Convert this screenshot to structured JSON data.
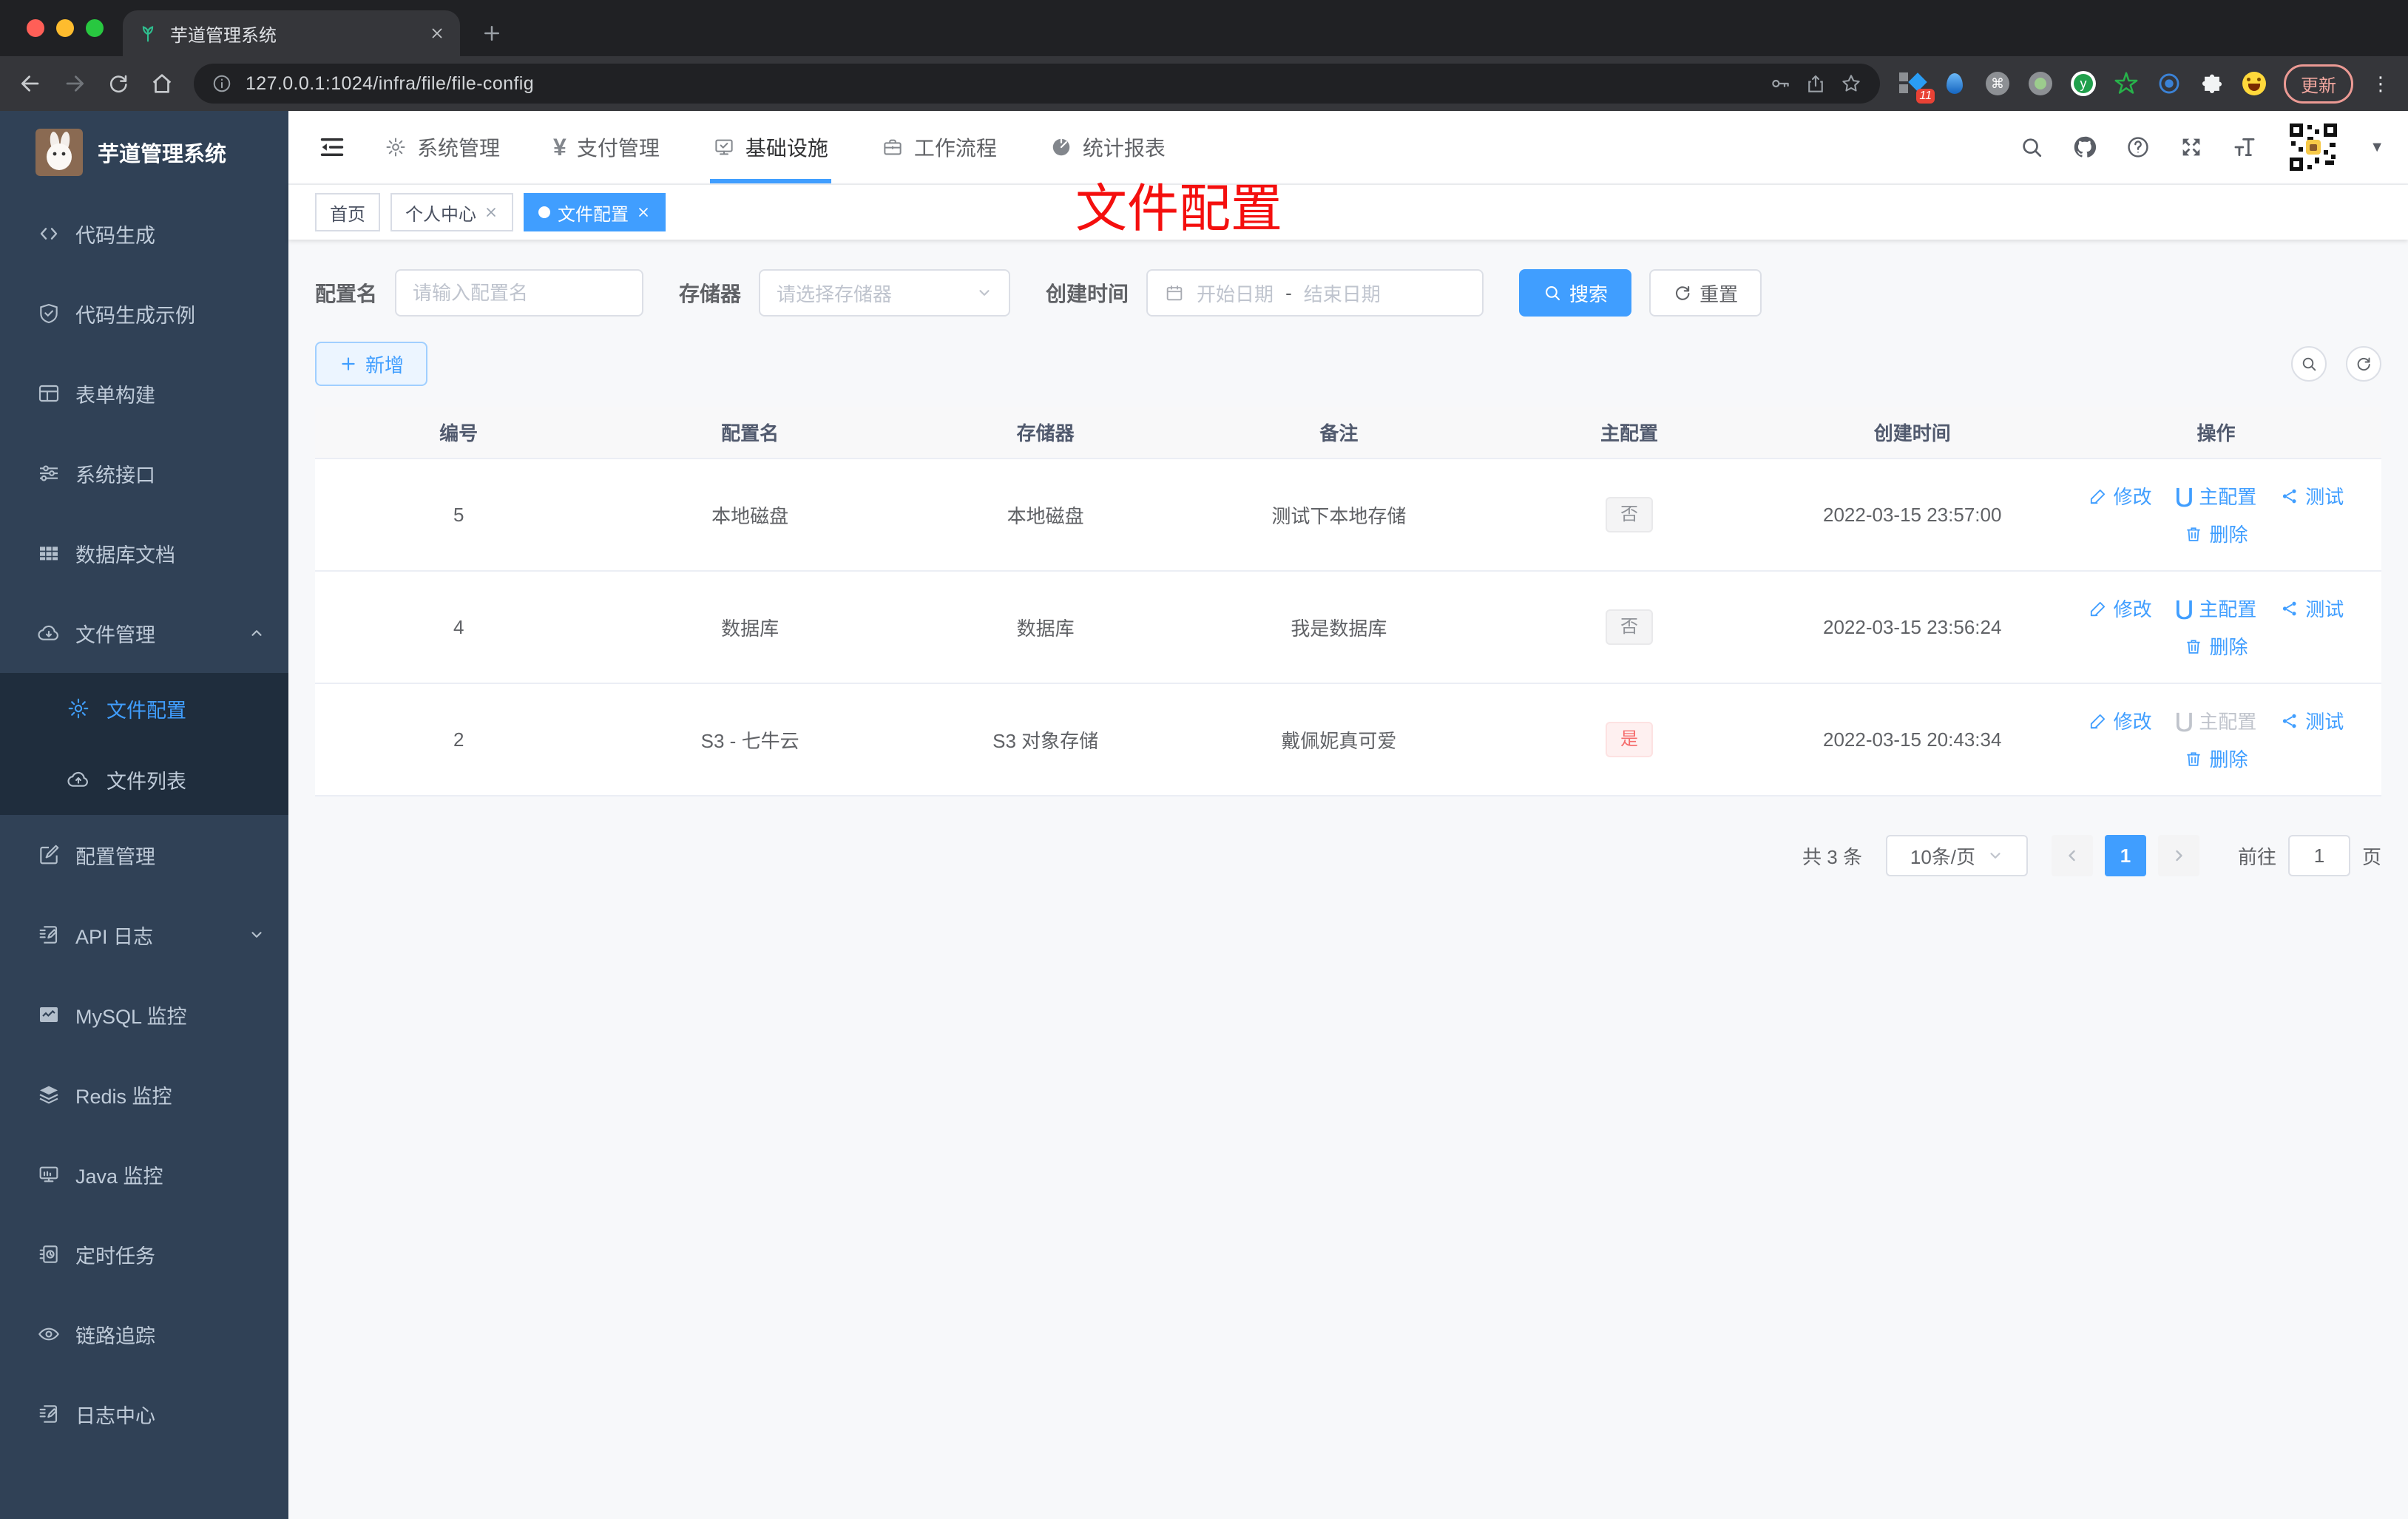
{
  "browser": {
    "tab_title": "芋道管理系统",
    "url": "127.0.0.1:1024/infra/file/file-config",
    "update_label": "更新",
    "extension_badge": "11"
  },
  "overlay": {
    "title": "文件配置"
  },
  "sidebar": {
    "logo_title": "芋道管理系统",
    "items": [
      {
        "label": "代码生成"
      },
      {
        "label": "代码生成示例"
      },
      {
        "label": "表单构建"
      },
      {
        "label": "系统接口"
      },
      {
        "label": "数据库文档"
      },
      {
        "label": "文件管理"
      },
      {
        "label": "文件配置"
      },
      {
        "label": "文件列表"
      },
      {
        "label": "配置管理"
      },
      {
        "label": "API 日志"
      },
      {
        "label": "MySQL 监控"
      },
      {
        "label": "Redis 监控"
      },
      {
        "label": "Java 监控"
      },
      {
        "label": "定时任务"
      },
      {
        "label": "链路追踪"
      },
      {
        "label": "日志中心"
      }
    ]
  },
  "header": {
    "menus": [
      {
        "label": "系统管理"
      },
      {
        "label": "支付管理"
      },
      {
        "label": "基础设施"
      },
      {
        "label": "工作流程"
      },
      {
        "label": "统计报表"
      }
    ]
  },
  "tags": [
    {
      "label": "首页"
    },
    {
      "label": "个人中心"
    },
    {
      "label": "文件配置"
    }
  ],
  "filters": {
    "name_label": "配置名",
    "name_placeholder": "请输入配置名",
    "storage_label": "存储器",
    "storage_placeholder": "请选择存储器",
    "time_label": "创建时间",
    "start_placeholder": "开始日期",
    "range_separator": "-",
    "end_placeholder": "结束日期",
    "search_label": "搜索",
    "reset_label": "重置"
  },
  "toolbar": {
    "add_label": "新增"
  },
  "table": {
    "headers": [
      "编号",
      "配置名",
      "存储器",
      "备注",
      "主配置",
      "创建时间",
      "操作"
    ],
    "actions": {
      "edit": "修改",
      "master": "主配置",
      "test": "测试",
      "delete": "删除"
    },
    "rows": [
      {
        "id": "5",
        "name": "本地磁盘",
        "storage": "本地磁盘",
        "remark": "测试下本地存储",
        "master": "否",
        "created": "2022-03-15 23:57:00"
      },
      {
        "id": "4",
        "name": "数据库",
        "storage": "数据库",
        "remark": "我是数据库",
        "master": "否",
        "created": "2022-03-15 23:56:24"
      },
      {
        "id": "2",
        "name": "S3 - 七牛云",
        "storage": "S3 对象存储",
        "remark": "戴佩妮真可爱",
        "master": "是",
        "created": "2022-03-15 20:43:34"
      }
    ]
  },
  "pagination": {
    "total": "共 3 条",
    "page_size": "10条/页",
    "current_page": "1",
    "goto_label": "前往",
    "goto_value": "1",
    "page_unit": "页"
  }
}
